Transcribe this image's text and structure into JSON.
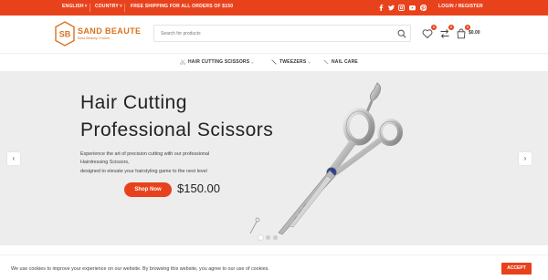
{
  "colors": {
    "accent": "#e8421d",
    "brand": "#d9721f"
  },
  "topbar": {
    "language": "ENGLISH",
    "country": "COUNTRY",
    "promo": "FREE SHIPPING FOR ALL ORDERS OF $150",
    "social_icons": [
      "facebook-icon",
      "twitter-icon",
      "instagram-icon",
      "youtube-icon",
      "pinterest-icon"
    ],
    "login": "LOGIN / REGISTER"
  },
  "header": {
    "logo_mark": "SB",
    "logo_name": "SAND BEAUTE",
    "logo_tagline": "Best Beauty Choice",
    "search_placeholder": "Search for products",
    "wishlist_count": "0",
    "compare_count": "0",
    "cart_count": "0",
    "cart_total": "$0.00"
  },
  "nav": {
    "items": [
      {
        "label": "HAIR CUTTING SCISSORS",
        "icon": "scissors-icon"
      },
      {
        "label": "TWEEZERS",
        "icon": "tweezers-icon"
      },
      {
        "label": "NAIL CARE",
        "icon": "nail-file-icon"
      }
    ]
  },
  "hero": {
    "title_line1": "Hair Cutting",
    "title_line2": "Professional Scissors",
    "desc_line1": "Experience the art of precision cutting with our professional",
    "desc_line2": "Hairdressing Scissors,",
    "desc_line3": "designed to elevate your hairstyling game to the next level",
    "button": "Shop Now",
    "price": "$150.00",
    "prev_arrow": "‹",
    "next_arrow": "›"
  },
  "cookie": {
    "text": "We use cookies to improve your experience on our website. By browsing this website, you agree to our use of cookies.",
    "accept": "ACCEPT"
  }
}
